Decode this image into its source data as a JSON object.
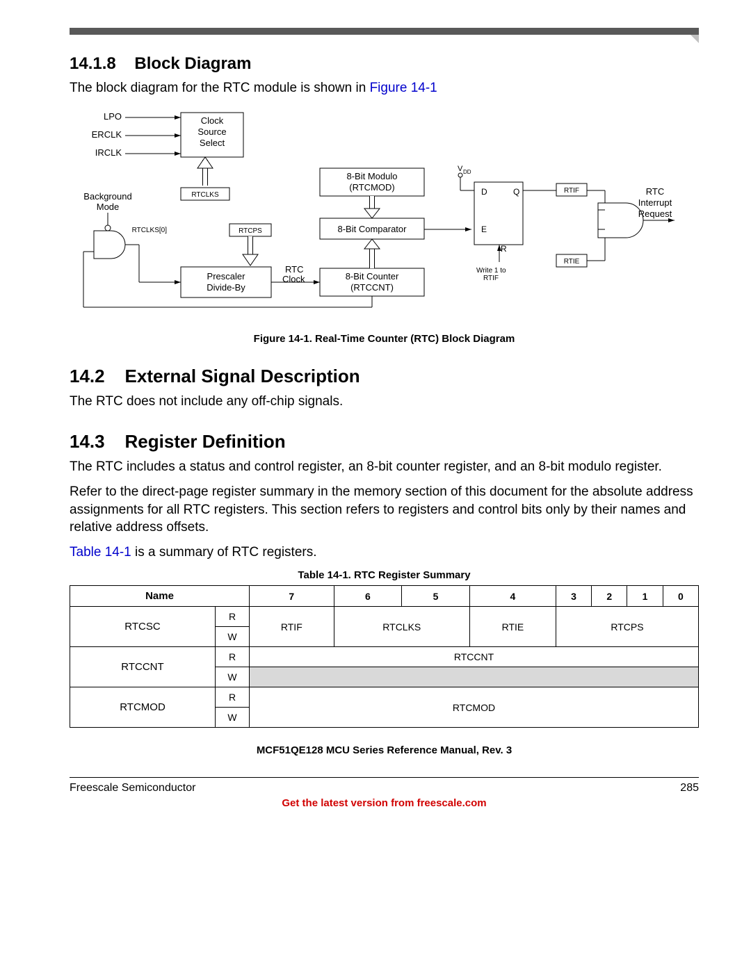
{
  "sections": {
    "s1": {
      "num": "14.1.8",
      "title": "Block Diagram",
      "para": "The block diagram for the RTC module is shown in ",
      "figref": "Figure 14-1"
    },
    "s2": {
      "num": "14.2",
      "title": "External Signal Description",
      "para": "The RTC does not include any off-chip signals."
    },
    "s3": {
      "num": "14.3",
      "title": "Register Definition",
      "p1": "The RTC includes a status and control register, an 8-bit counter register, and an 8-bit modulo register.",
      "p2": "Refer to the direct-page register summary in the memory section of this document for the absolute address assignments for all RTC registers. This section refers to registers and control bits only by their names and relative address offsets.",
      "p3a": "Table 14-1",
      "p3b": " is a summary of RTC registers."
    }
  },
  "diagram": {
    "caption": "Figure 14-1. Real-Time Counter (RTC) Block Diagram",
    "labels": {
      "lpo": "LPO",
      "erclk": "ERCLK",
      "irclk": "IRCLK",
      "css": "Clock\nSource\nSelect",
      "background": "Background\nMode",
      "rtclks": "RTCLKS",
      "rtclks0": "RTCLKS[0]",
      "rtcps": "RTCPS",
      "prescaler": "Prescaler\nDivide-By",
      "rtcclock": "RTC\nClock",
      "mod": "8-Bit Modulo\n(RTCMOD)",
      "comp": "8-Bit Comparator",
      "cnt": "8-Bit Counter\n(RTCCNT)",
      "vdd": "VDD",
      "d": "D",
      "q": "Q",
      "e": "E",
      "r": "R",
      "write": "Write 1 to\nRTIF",
      "rtif": "RTIF",
      "rtie": "RTIE",
      "irq": "RTC\nInterrupt\nRequest"
    }
  },
  "table": {
    "caption": "Table 14-1. RTC Register Summary",
    "head": {
      "name": "Name",
      "bits": [
        "7",
        "6",
        "5",
        "4",
        "3",
        "2",
        "1",
        "0"
      ]
    },
    "rows": [
      {
        "name": "RTCSC",
        "r": [
          "RTIF",
          "RTCLKS",
          "RTIE",
          "RTCPS"
        ],
        "rspan": [
          1,
          2,
          1,
          4
        ],
        "wsame": true
      },
      {
        "name": "RTCCNT",
        "r": "RTCCNT",
        "wshaded": true
      },
      {
        "name": "RTCMOD",
        "r": "RTCMOD",
        "wsame": true,
        "rowspan2": true
      }
    ]
  },
  "footer": {
    "doc": "MCF51QE128 MCU Series Reference Manual, Rev. 3",
    "left": "Freescale Semiconductor",
    "right": "285",
    "red": "Get the latest version from freescale.com"
  }
}
